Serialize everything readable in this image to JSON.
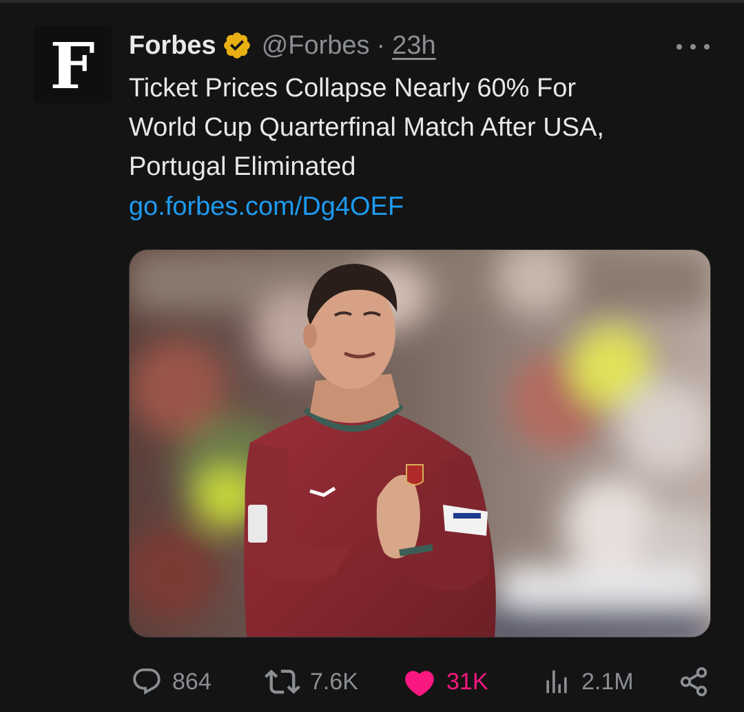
{
  "author": {
    "avatar_letter": "F",
    "display_name": "Forbes",
    "verified_color": "#e8b012",
    "handle": "@Forbes",
    "separator": "·",
    "time": "23h"
  },
  "tweet": {
    "text_lines": [
      "Ticket Prices Collapse Nearly 60% For",
      "World Cup Quarterfinal Match After USA,",
      "Portugal Eliminated"
    ],
    "link": "go.forbes.com/Dg4OEF",
    "link_color": "#1d9bf0"
  },
  "media": {
    "icon": "photo-of-soccer-player-in-red-jersey"
  },
  "actions": {
    "replies": "864",
    "reposts": "7.6K",
    "likes": "31K",
    "views": "2.1M",
    "like_color": "#f91880"
  },
  "icons": {
    "reply": "reply-icon",
    "repost": "repost-icon",
    "like": "heart-icon",
    "views": "views-icon",
    "share": "share-icon",
    "more": "more-icon",
    "verified": "verified-badge-icon"
  }
}
